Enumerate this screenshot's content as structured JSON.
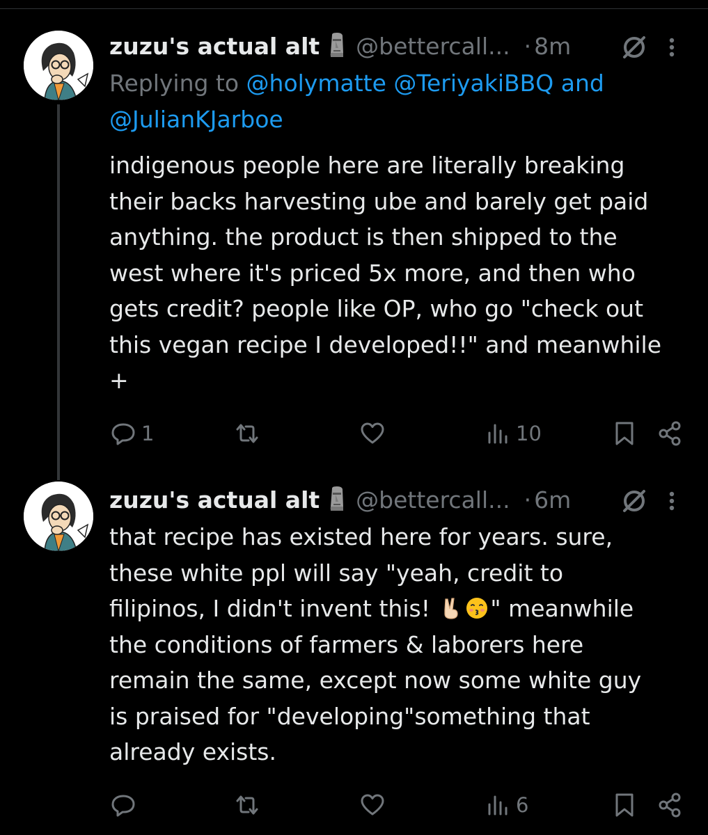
{
  "tweets": [
    {
      "display_name": "zuzu's actual alt",
      "handle": "@bettercall...",
      "separator": "·",
      "time": "8m",
      "reply": {
        "prefix": "Replying to",
        "mentions": [
          "@holymatte",
          "@TeriyakiBBQ"
        ],
        "conjunction": "and",
        "last_mention": "@JulianKJarboe"
      },
      "lines": [
        "indigenous people here are literally breaking",
        "their backs harvesting ube and barely get paid",
        "anything. the product is then shipped to the",
        "west where it's priced 5x more, and then who",
        "gets credit? people like OP, who go \"check out",
        "this vegan recipe I developed!!\" and meanwhile",
        "+"
      ],
      "stats": {
        "replies": "1",
        "reposts": "",
        "likes": "",
        "views": "10"
      }
    },
    {
      "display_name": "zuzu's actual alt",
      "handle": "@bettercall...",
      "separator": "·",
      "time": "6m",
      "lines_before_emoji": [
        "that recipe has existed here for years. sure,",
        "these white ppl will say \"yeah, credit to"
      ],
      "emoji_line": {
        "before": "filipinos, I didn't invent this! ",
        "after": "\" meanwhile"
      },
      "lines_after_emoji": [
        "the conditions of farmers & laborers here",
        "remain the same, except now some white guy",
        "is praised for \"developing\"something that",
        "already exists."
      ],
      "stats": {
        "replies": "",
        "reposts": "",
        "likes": "",
        "views": "6"
      }
    }
  ],
  "icons": {
    "avatar": "avatar-illustration",
    "name_emoji": "moai-icon",
    "grok": "grok-icon",
    "more": "more-icon",
    "reply": "reply-icon",
    "repost": "repost-icon",
    "like": "heart-icon",
    "views": "views-chart-icon",
    "bookmark": "bookmark-icon",
    "share": "share-icon",
    "emoji_1": "victory-hand-emoji",
    "emoji_2": "kissing-face-emoji"
  },
  "colors": {
    "background": "#000000",
    "primary_text": "#e7e9ea",
    "secondary_text": "#71767b",
    "link": "#1d9bf0",
    "thread_line": "#333639"
  }
}
